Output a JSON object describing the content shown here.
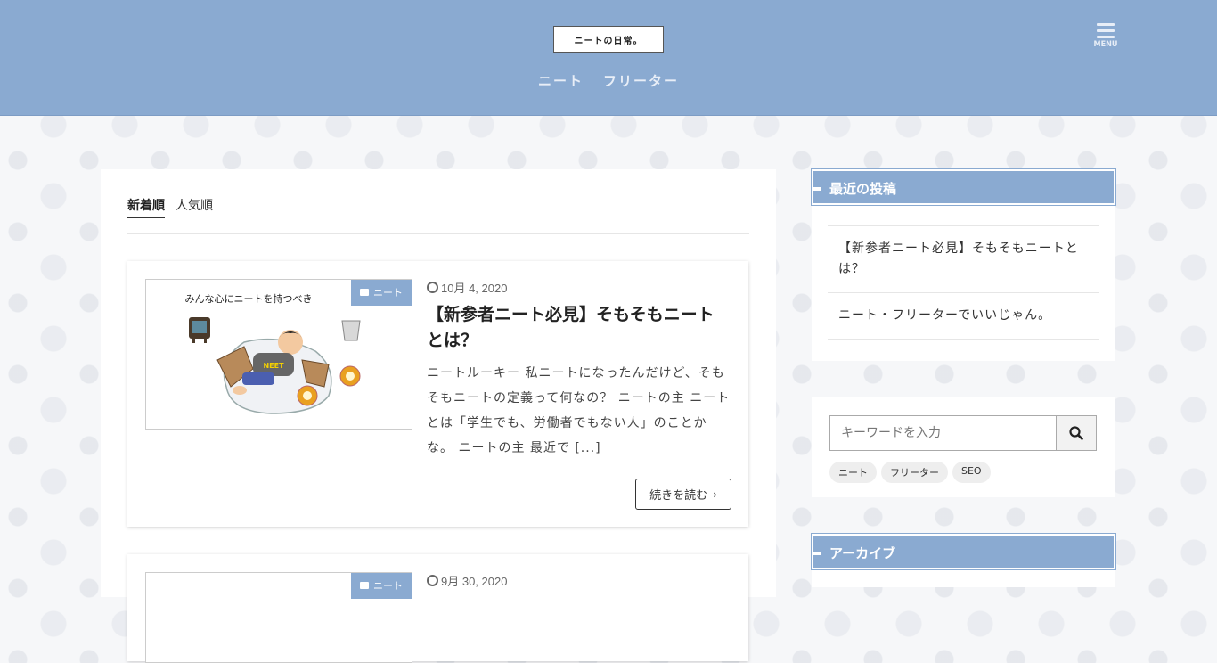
{
  "header": {
    "logo_text": "ニートの日常。",
    "nav": [
      "ニート",
      "フリーター"
    ],
    "menu_label": "MENU"
  },
  "main": {
    "tabs": [
      "新着順",
      "人気順"
    ],
    "posts": [
      {
        "category": "ニート",
        "date": "10月 4, 2020",
        "title": "【新参者ニート必見】そもそもニートとは？",
        "thumb_caption": "みんな心にニートを持つべき",
        "thumb_shirt": "NEET",
        "excerpt": "ニートルーキー 私ニートになったんだけど、そもそもニートの定義って何なの？ ニートの主 ニートとは「学生でも、労働者でもない人」のことかな。 ニートの主 最近で [...]",
        "more_label": "続きを読む"
      },
      {
        "category": "ニート",
        "date": "9月 30, 2020"
      }
    ]
  },
  "sidebar": {
    "recent_title": "最近の投稿",
    "recent_posts": [
      "【新参者ニート必見】そもそもニートとは？",
      "ニート・フリーターでいいじゃん。"
    ],
    "search_placeholder": "キーワードを入力",
    "tags": [
      "ニート",
      "フリーター",
      "SEO"
    ],
    "archive_title": "アーカイブ"
  },
  "colors": {
    "accent": "#8aaad1"
  }
}
